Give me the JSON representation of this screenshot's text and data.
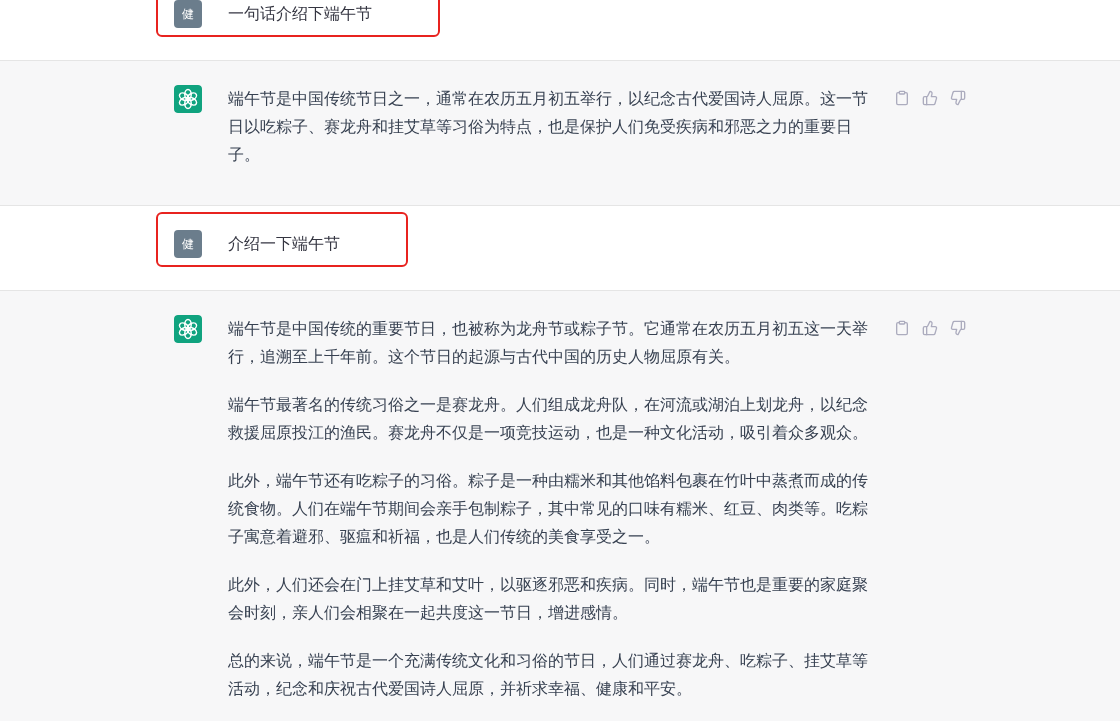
{
  "messages": [
    {
      "kind": "user",
      "avatar": "健",
      "text": "一句话介绍下端午节",
      "highlighted": true
    },
    {
      "kind": "assistant",
      "paragraphs": [
        "端午节是中国传统节日之一，通常在农历五月初五举行，以纪念古代爱国诗人屈原。这一节日以吃粽子、赛龙舟和挂艾草等习俗为特点，也是保护人们免受疾病和邪恶之力的重要日子。"
      ]
    },
    {
      "kind": "user",
      "avatar": "健",
      "text": "介绍一下端午节",
      "highlighted": true
    },
    {
      "kind": "assistant",
      "paragraphs": [
        "端午节是中国传统的重要节日，也被称为龙舟节或粽子节。它通常在农历五月初五这一天举行，追溯至上千年前。这个节日的起源与古代中国的历史人物屈原有关。",
        "端午节最著名的传统习俗之一是赛龙舟。人们组成龙舟队，在河流或湖泊上划龙舟，以纪念救援屈原投江的渔民。赛龙舟不仅是一项竞技运动，也是一种文化活动，吸引着众多观众。",
        "此外，端午节还有吃粽子的习俗。粽子是一种由糯米和其他馅料包裹在竹叶中蒸煮而成的传统食物。人们在端午节期间会亲手包制粽子，其中常见的口味有糯米、红豆、肉类等。吃粽子寓意着避邪、驱瘟和祈福，也是人们传统的美食享受之一。",
        "此外，人们还会在门上挂艾草和艾叶，以驱逐邪恶和疾病。同时，端午节也是重要的家庭聚会时刻，亲人们会相聚在一起共度这一节日，增进感情。",
        "总的来说，端午节是一个充满传统文化和习俗的节日，人们通过赛龙舟、吃粽子、挂艾草等活动，纪念和庆祝古代爱国诗人屈原，并祈求幸福、健康和平安。"
      ]
    }
  ]
}
